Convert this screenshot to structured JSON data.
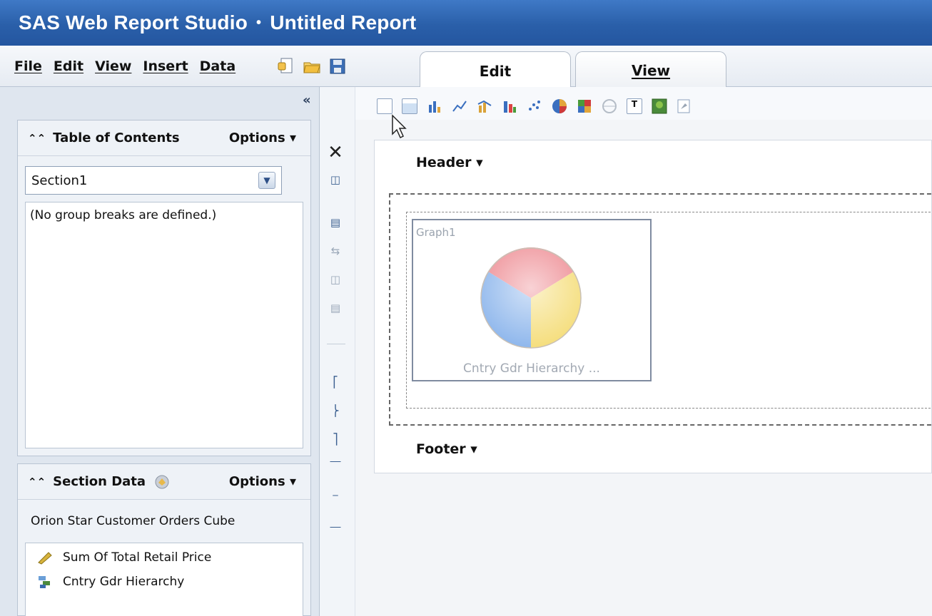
{
  "window": {
    "app_title": "SAS Web Report Studio",
    "separator": "•",
    "doc_title": "Untitled Report"
  },
  "menu": {
    "file": "File",
    "edit": "Edit",
    "view": "View",
    "insert": "Insert",
    "data": "Data"
  },
  "toolbar_icons": [
    "new-icon",
    "open-folder-icon",
    "save-icon"
  ],
  "tabs": {
    "edit": "Edit",
    "view": "View",
    "active": "Edit"
  },
  "left_panel": {
    "collapse_glyph": "«",
    "toc": {
      "title": "Table of Contents",
      "options": "Options",
      "selected_section": "Section1",
      "empty_message": "(No group breaks are defined.)"
    },
    "section_data": {
      "title": "Section Data",
      "options": "Options",
      "source": "Orion Star Customer Orders Cube",
      "items": [
        {
          "label": "Sum Of Total Retail Price",
          "icon": "measure-icon"
        },
        {
          "label": "Cntry Gdr Hierarchy",
          "icon": "hierarchy-icon"
        }
      ]
    }
  },
  "insert_toolbar_icons": [
    "table-icon",
    "crosstab-icon",
    "bar-chart-icon",
    "line-chart-icon",
    "bar-line-chart-icon",
    "progressive-bar-icon",
    "scatter-plot-icon",
    "pie-chart-icon",
    "tile-chart-icon",
    "geo-map-icon",
    "text-icon",
    "image-icon",
    "stored-process-icon"
  ],
  "report": {
    "header_label": "Header",
    "footer_label": "Footer",
    "graph": {
      "name": "Graph1",
      "caption": "Cntry Gdr Hierarchy ...",
      "slice_colors": [
        "#ee8f96",
        "#f5de7d",
        "#8fb7ec"
      ]
    }
  }
}
